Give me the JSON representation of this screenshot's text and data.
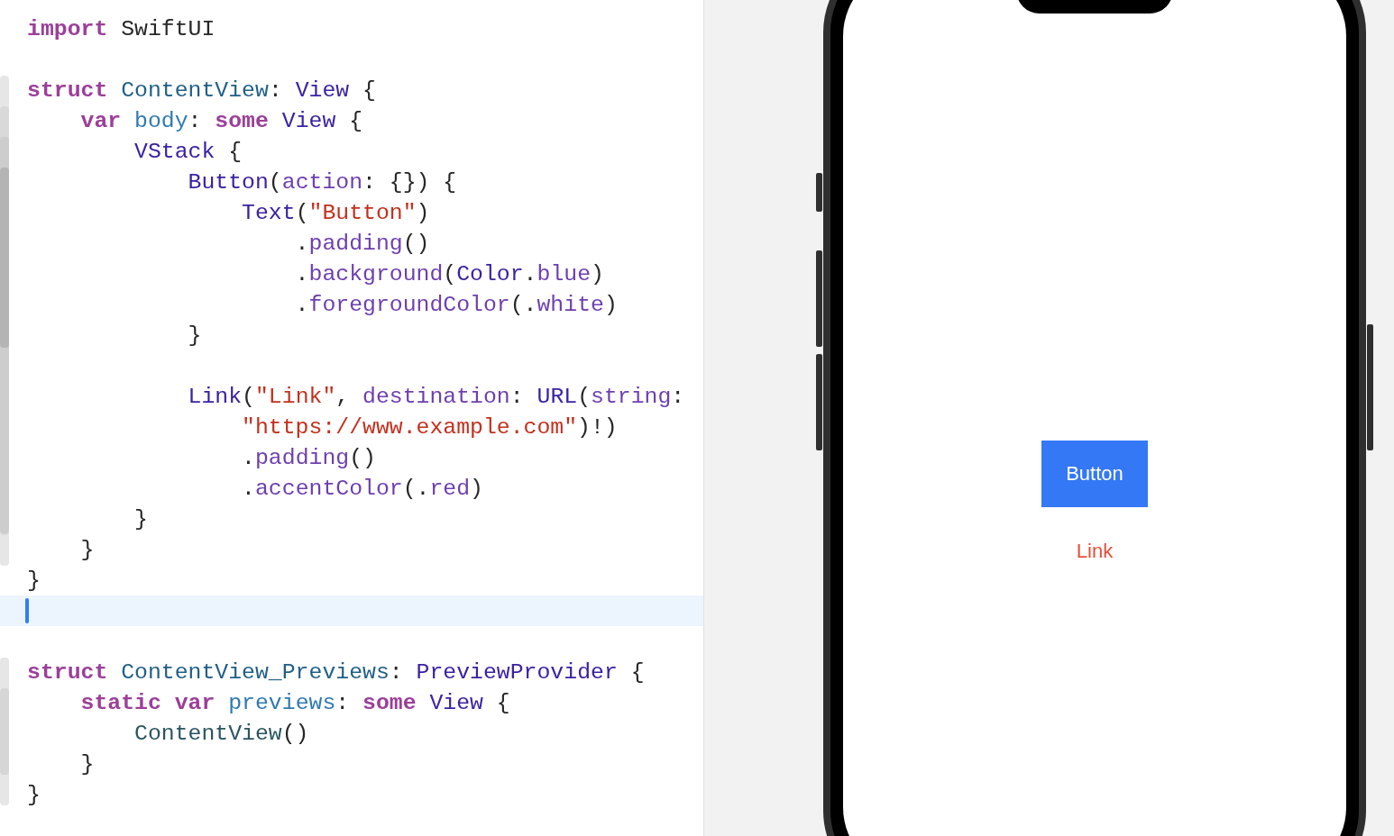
{
  "editor": {
    "lines": [
      {
        "current": false,
        "tokens": [
          {
            "text": "import",
            "kind": "kw"
          },
          {
            "text": " SwiftUI",
            "kind": "plain"
          }
        ]
      },
      {
        "current": false
      },
      {
        "current": false,
        "tokens": [
          {
            "text": "struct",
            "kind": "kw"
          },
          {
            "text": " ContentView",
            "kind": "decl"
          },
          {
            "text": ": ",
            "kind": "plain"
          },
          {
            "text": "View",
            "kind": "type"
          },
          {
            "text": " {",
            "kind": "plain"
          }
        ]
      },
      {
        "current": false,
        "tokens": [
          {
            "text": "    var",
            "kind": "kw"
          },
          {
            "text": " body",
            "kind": "var"
          },
          {
            "text": ": ",
            "kind": "plain"
          },
          {
            "text": "some",
            "kind": "kw"
          },
          {
            "text": " View",
            "kind": "type"
          },
          {
            "text": " {",
            "kind": "plain"
          }
        ]
      },
      {
        "current": false,
        "tokens": [
          {
            "text": "        VStack",
            "kind": "type"
          },
          {
            "text": " {",
            "kind": "plain"
          }
        ]
      },
      {
        "current": false,
        "tokens": [
          {
            "text": "            Button",
            "kind": "type"
          },
          {
            "text": "(",
            "kind": "plain"
          },
          {
            "text": "action",
            "kind": "member"
          },
          {
            "text": ": {}) {",
            "kind": "plain"
          }
        ]
      },
      {
        "current": false,
        "tokens": [
          {
            "text": "                Text",
            "kind": "type"
          },
          {
            "text": "(",
            "kind": "plain"
          },
          {
            "text": "\"Button\"",
            "kind": "str"
          },
          {
            "text": ")",
            "kind": "plain"
          }
        ]
      },
      {
        "current": false,
        "tokens": [
          {
            "text": "                    .",
            "kind": "plain"
          },
          {
            "text": "padding",
            "kind": "member"
          },
          {
            "text": "()",
            "kind": "plain"
          }
        ]
      },
      {
        "current": false,
        "tokens": [
          {
            "text": "                    .",
            "kind": "plain"
          },
          {
            "text": "background",
            "kind": "member"
          },
          {
            "text": "(",
            "kind": "plain"
          },
          {
            "text": "Color",
            "kind": "type"
          },
          {
            "text": ".",
            "kind": "plain"
          },
          {
            "text": "blue",
            "kind": "member"
          },
          {
            "text": ")",
            "kind": "plain"
          }
        ]
      },
      {
        "current": false,
        "tokens": [
          {
            "text": "                    .",
            "kind": "plain"
          },
          {
            "text": "foregroundColor",
            "kind": "member"
          },
          {
            "text": "(.",
            "kind": "plain"
          },
          {
            "text": "white",
            "kind": "member"
          },
          {
            "text": ")",
            "kind": "plain"
          }
        ]
      },
      {
        "current": false,
        "tokens": [
          {
            "text": "            }",
            "kind": "plain"
          }
        ]
      },
      {
        "current": false
      },
      {
        "current": false,
        "tokens": [
          {
            "text": "            Link",
            "kind": "type"
          },
          {
            "text": "(",
            "kind": "plain"
          },
          {
            "text": "\"Link\"",
            "kind": "str"
          },
          {
            "text": ", ",
            "kind": "plain"
          },
          {
            "text": "destination",
            "kind": "member"
          },
          {
            "text": ": ",
            "kind": "plain"
          },
          {
            "text": "URL",
            "kind": "type"
          },
          {
            "text": "(",
            "kind": "plain"
          },
          {
            "text": "string",
            "kind": "member"
          },
          {
            "text": ":",
            "kind": "plain"
          }
        ]
      },
      {
        "current": false,
        "tokens": [
          {
            "text": "                \"https://www.example.com\"",
            "kind": "str"
          },
          {
            "text": ")!)",
            "kind": "plain"
          }
        ]
      },
      {
        "current": false,
        "tokens": [
          {
            "text": "                .",
            "kind": "plain"
          },
          {
            "text": "padding",
            "kind": "member"
          },
          {
            "text": "()",
            "kind": "plain"
          }
        ]
      },
      {
        "current": false,
        "tokens": [
          {
            "text": "                .",
            "kind": "plain"
          },
          {
            "text": "accentColor",
            "kind": "member"
          },
          {
            "text": "(.",
            "kind": "plain"
          },
          {
            "text": "red",
            "kind": "member"
          },
          {
            "text": ")",
            "kind": "plain"
          }
        ]
      },
      {
        "current": false,
        "tokens": [
          {
            "text": "        }",
            "kind": "plain"
          }
        ]
      },
      {
        "current": false,
        "tokens": [
          {
            "text": "    }",
            "kind": "plain"
          }
        ]
      },
      {
        "current": false,
        "tokens": [
          {
            "text": "}",
            "kind": "plain"
          }
        ]
      },
      {
        "current": true
      },
      {
        "current": false
      },
      {
        "current": false,
        "tokens": [
          {
            "text": "struct",
            "kind": "kw"
          },
          {
            "text": " ContentView_Previews",
            "kind": "decl"
          },
          {
            "text": ": ",
            "kind": "plain"
          },
          {
            "text": "PreviewProvider",
            "kind": "type"
          },
          {
            "text": " {",
            "kind": "plain"
          }
        ]
      },
      {
        "current": false,
        "tokens": [
          {
            "text": "    static",
            "kind": "kw"
          },
          {
            "text": " var",
            "kind": "kw"
          },
          {
            "text": " previews",
            "kind": "var"
          },
          {
            "text": ": ",
            "kind": "plain"
          },
          {
            "text": "some",
            "kind": "kw"
          },
          {
            "text": " View",
            "kind": "type"
          },
          {
            "text": " {",
            "kind": "plain"
          }
        ]
      },
      {
        "current": false,
        "tokens": [
          {
            "text": "        ContentView",
            "kind": "ref"
          },
          {
            "text": "()",
            "kind": "plain"
          }
        ]
      },
      {
        "current": false,
        "tokens": [
          {
            "text": "    }",
            "kind": "plain"
          }
        ]
      },
      {
        "current": false,
        "tokens": [
          {
            "text": "}",
            "kind": "plain"
          }
        ]
      }
    ]
  },
  "preview": {
    "button": {
      "label": "Button"
    },
    "link": {
      "label": "Link"
    }
  }
}
